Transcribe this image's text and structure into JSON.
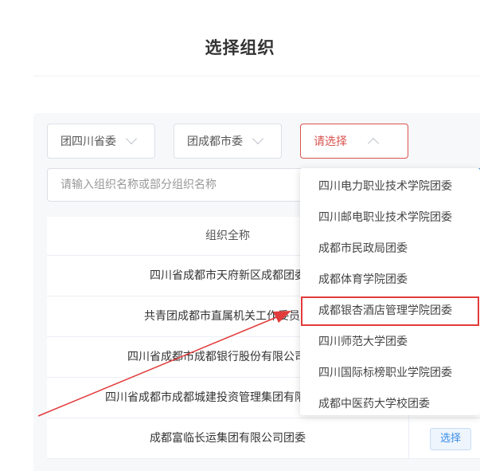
{
  "page": {
    "title": "选择组织"
  },
  "filters": {
    "province": {
      "value": "团四川省委"
    },
    "city": {
      "value": "团成都市委"
    },
    "unit": {
      "value": "请选择"
    }
  },
  "search": {
    "placeholder": "请输入组织名称或部分组织名称"
  },
  "table": {
    "header": {
      "name": "组织全称"
    },
    "rows": [
      {
        "name": "四川省成都市天府新区成都团委"
      },
      {
        "name": "共青团成都市直属机关工作委员会"
      },
      {
        "name": "四川省成都市成都银行股份有限公司团委"
      },
      {
        "name": "四川省成都市成都城建投资管理集团有限公司团委"
      },
      {
        "name": "成都富临长运集团有限公司团委",
        "action": "选择"
      }
    ]
  },
  "dropdown": {
    "options": [
      "四川电力职业技术学院团委",
      "四川邮电职业技术学院团委",
      "成都市民政局团委",
      "成都体育学院团委",
      "成都银杏酒店管理学院团委",
      "四川师范大学团委",
      "四川国际标榜职业学院团委",
      "成都中医药大学校团委"
    ],
    "highlighted_index": 4
  },
  "colors": {
    "highlight": "#e23b3b",
    "primary": "#4a90e2"
  }
}
